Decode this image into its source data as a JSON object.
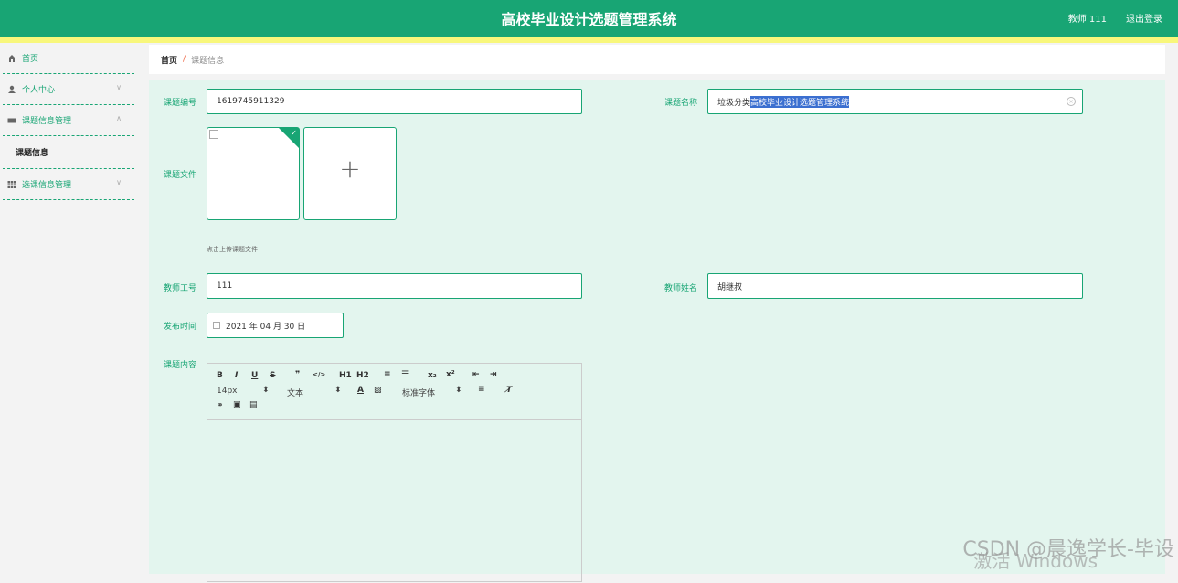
{
  "header": {
    "title": "高校毕业设计选题管理系统",
    "user": "教师 111",
    "logout": "退出登录"
  },
  "sidebar": {
    "items": [
      {
        "label": "首页",
        "icon": "home-icon"
      },
      {
        "label": "个人中心",
        "icon": "user-icon"
      },
      {
        "label": "课题信息管理",
        "icon": "ticket-icon"
      },
      {
        "label": "课题信息",
        "icon": ""
      },
      {
        "label": "选课信息管理",
        "icon": "grid-icon"
      }
    ]
  },
  "breadcrumb": {
    "home": "首页",
    "sep": "/",
    "current": "课题信息"
  },
  "form": {
    "topic_no_label": "课题编号",
    "topic_no_value": "1619745911329",
    "topic_name_label": "课题名称",
    "topic_name_prefix": "垃圾分类",
    "topic_name_selected": "高校毕业设计选题管理系统",
    "file_label": "课题文件",
    "file_hint": "点击上传课题文件",
    "teacher_no_label": "教师工号",
    "teacher_no_value": "111",
    "teacher_name_label": "教师姓名",
    "teacher_name_value": "胡继叔",
    "publish_label": "发布时间",
    "publish_value": "2021 年 04 月 30 日",
    "content_label": "课题内容"
  },
  "editor": {
    "row1": [
      "B",
      "I",
      "U",
      "S",
      "❞",
      "</>",
      "H1",
      "H2",
      "≡",
      "☰",
      "x₂",
      "x²",
      "⇤",
      "⇥"
    ],
    "font_size": "14px",
    "text_style": "文本",
    "font_family": "标准字体"
  },
  "watermark": {
    "csdn": "CSDN @晨逸学长-毕设",
    "windows": "激活 Windows"
  }
}
